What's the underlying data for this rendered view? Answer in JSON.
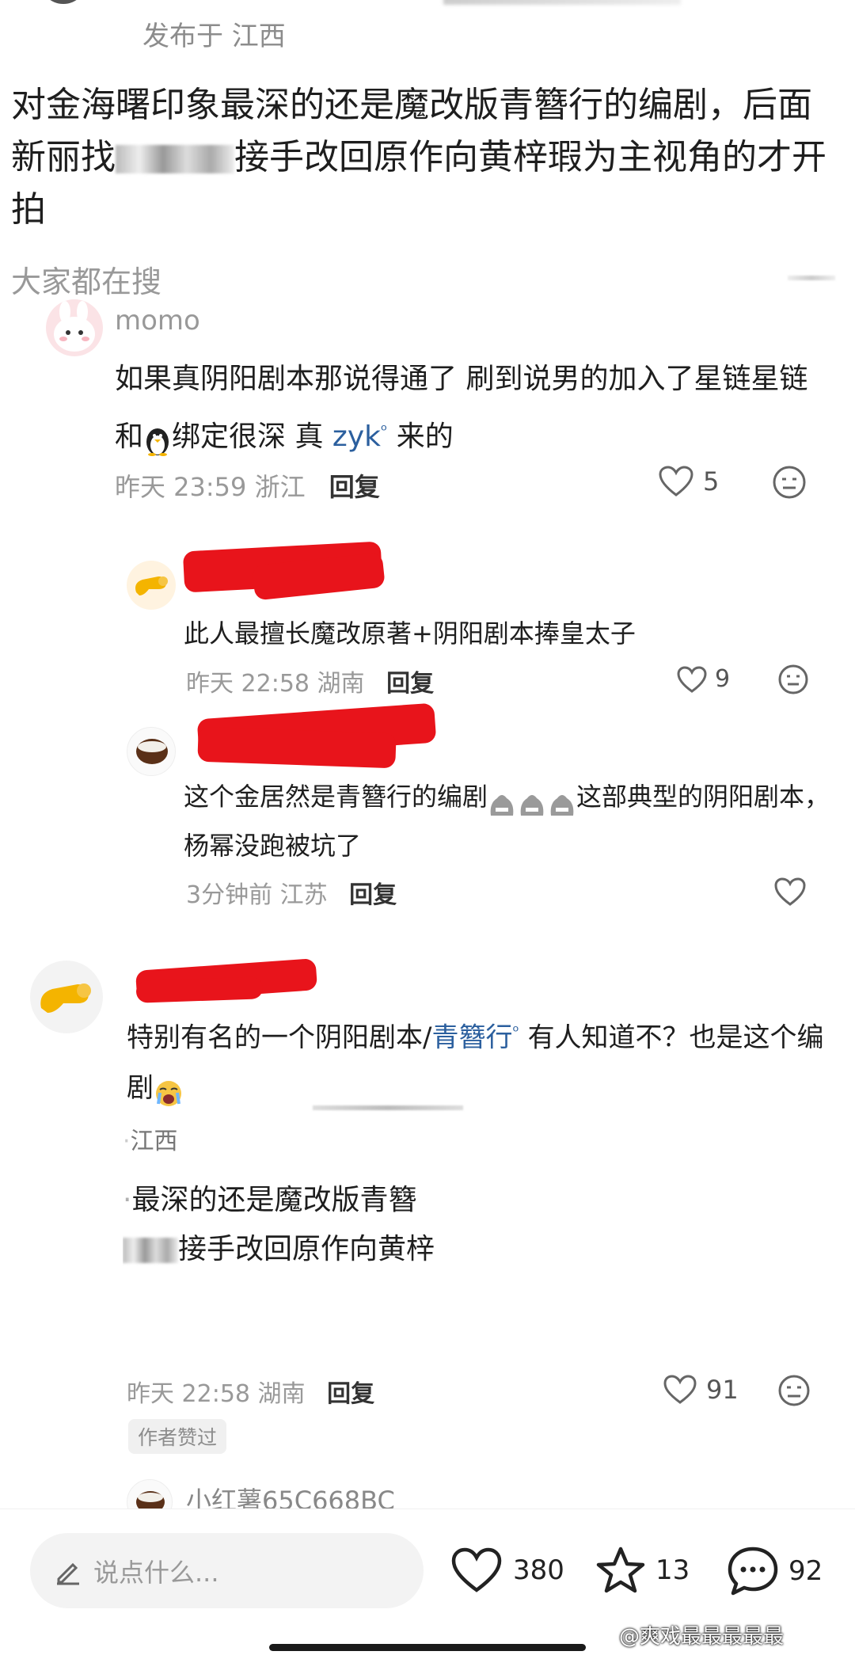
{
  "top_post": {
    "meta": "发布于 江西",
    "text_before_blur": "对金海曙印象最深的还是魔改版青簪行的编剧，后面新丽找",
    "text_after_blur": "接手改回原作向黄梓瑕为主视角的才开拍"
  },
  "search_hint": "大家都在搜",
  "comments": [
    {
      "username": "momo",
      "text_1": "如果真阴阳剧本那说得通了 刷到说男的加入了星链星链和",
      "text_2": "绑定很深 真",
      "link": "zyk",
      "text_3": "来的",
      "time": "昨天 23:59 浙江",
      "reply": "回复",
      "likes": "5"
    },
    {
      "text": "此人最擅长魔改原著+阴阳剧本捧皇太子",
      "time": "昨天 22:58 湖南",
      "reply": "回复",
      "likes": "9"
    },
    {
      "text_1": "这个金居然是青簪行的编剧",
      "text_2": "这部典型的阴阳剧本，杨幂没跑被坑了",
      "time": "3分钟前 江苏",
      "reply": "回复"
    },
    {
      "text_1": "特别有名的一个阴阳剧本/",
      "link": "青簪行",
      "text_2": "有人知道不？也是这个编剧",
      "quote_loc": "江西",
      "quote_1": "最深的还是魔改版青簪",
      "quote_2": "接手改回原作向黄梓",
      "time": "昨天 22:58 湖南",
      "reply": "回复",
      "likes": "91",
      "author_badge": "作者赞过"
    },
    {
      "username": "小红薯65C668BC"
    }
  ],
  "bottom_bar": {
    "input_placeholder": "说点什么...",
    "likes": "380",
    "stars": "13",
    "comments": "92"
  },
  "watermark": "@爽戏最最最最最"
}
